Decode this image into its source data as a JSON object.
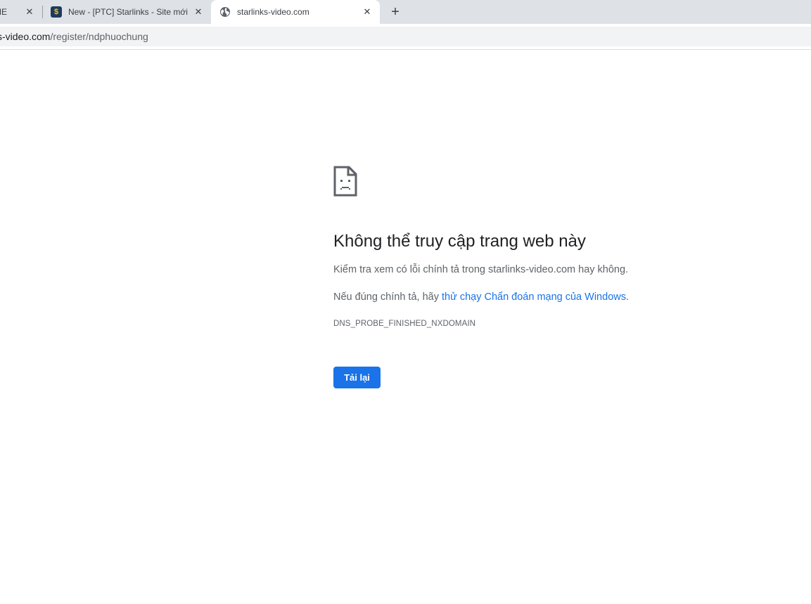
{
  "browser": {
    "tabs": [
      {
        "title": "ME",
        "close": "✕"
      },
      {
        "title": "New - [PTC] Starlinks - Site mới -",
        "favicon_glyph": "$",
        "close": "✕"
      },
      {
        "title": "starlinks-video.com",
        "close": "✕"
      }
    ],
    "new_tab": "+",
    "address": {
      "host": "s-video.com",
      "path": "/register/ndphuochung"
    }
  },
  "error_page": {
    "headline": "Không thể truy cập trang web này",
    "para1": "Kiểm tra xem có lỗi chính tả trong starlinks-video.com hay không.",
    "para2_prefix": "Nếu đúng chính tả, hãy ",
    "para2_link": "thử chạy Chẩn đoán mạng của Windows",
    "para2_suffix": ".",
    "error_code": "DNS_PROBE_FINISHED_NXDOMAIN",
    "reload_label": "Tải lại"
  },
  "colors": {
    "accent": "#1a73e8",
    "tabstrip": "#dee1e6",
    "text": "#202124",
    "secondary_text": "#5f6368"
  },
  "icons": {
    "error": "sad-document-icon",
    "tab3_favicon": "globe-icon",
    "tab2_favicon": "dollar-icon"
  }
}
